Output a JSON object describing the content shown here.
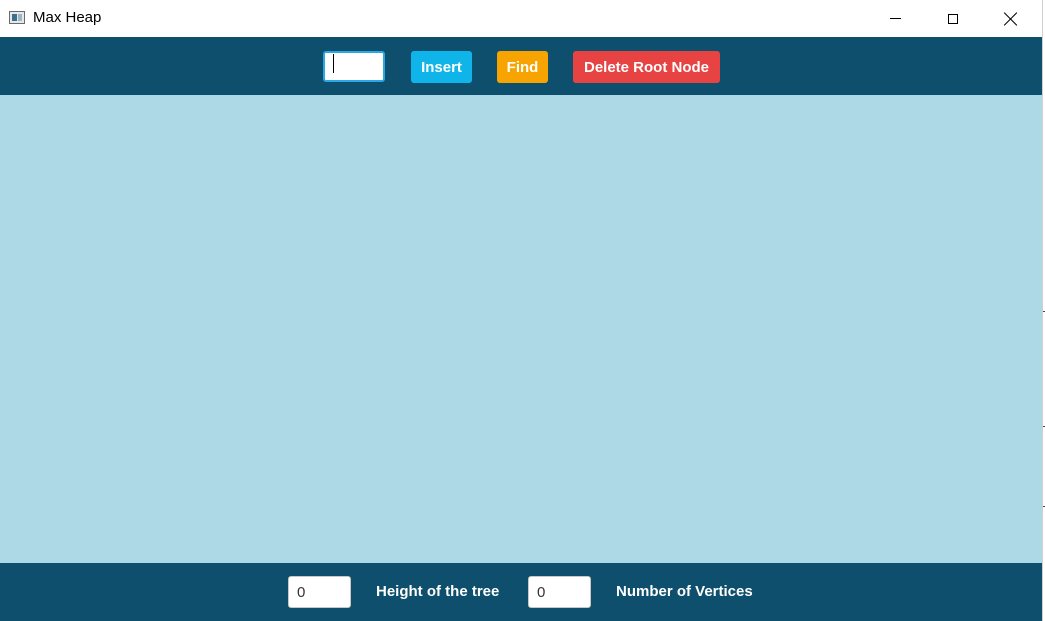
{
  "window": {
    "title": "Max Heap",
    "icon": "app-window-icon",
    "controls": [
      "minimize-icon",
      "maximize-icon",
      "close-icon"
    ]
  },
  "toolbar": {
    "value_input": {
      "value": "",
      "placeholder": ""
    },
    "insert_label": "Insert",
    "find_label": "Find",
    "delete_label": "Delete Root Node"
  },
  "stats": {
    "height_value": "0",
    "height_label": "Height of the tree",
    "vertices_value": "0",
    "vertices_label": "Number of Vertices"
  },
  "colors": {
    "toolbar_bg": "#0d4f6c",
    "canvas_bg": "#add8e6",
    "insert_btn": "#0fb5e8",
    "find_btn": "#f7a400",
    "delete_btn": "#e84343",
    "input_focus_border": "#2aa7e6"
  }
}
